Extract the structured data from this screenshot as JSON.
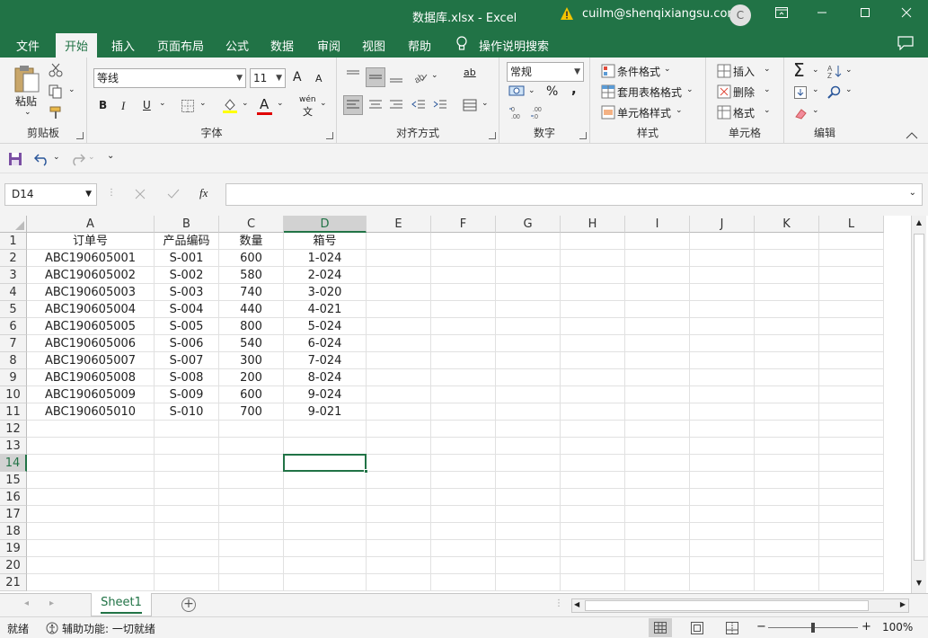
{
  "window": {
    "title": "数据库.xlsx  -  Excel",
    "user": "cuilm@shenqixiangsu.com",
    "avatar_initial": "C"
  },
  "menu": {
    "tabs": [
      "文件",
      "开始",
      "插入",
      "页面布局",
      "公式",
      "数据",
      "审阅",
      "视图",
      "帮助"
    ],
    "active_tab": "开始",
    "search": "操作说明搜索"
  },
  "ribbon": {
    "clipboard": {
      "paste": "粘贴",
      "group": "剪贴板"
    },
    "font": {
      "name": "等线",
      "size": "11",
      "grow": "A",
      "shrink": "A",
      "bold": "B",
      "italic": "I",
      "underline": "U",
      "font_color": "A",
      "phonetic_top": "wén",
      "phonetic_bottom": "文",
      "group": "字体"
    },
    "alignment": {
      "group": "对齐方式",
      "wrap": "ab"
    },
    "number": {
      "format": "常规",
      "percent": "%",
      "comma": ",",
      "group": "数字"
    },
    "styles": {
      "conditional": "条件格式",
      "table": "套用表格格式",
      "cell": "单元格样式",
      "group": "样式"
    },
    "cells": {
      "insert": "插入",
      "delete": "删除",
      "format": "格式",
      "group": "单元格"
    },
    "editing": {
      "group": "编辑"
    }
  },
  "formula_bar": {
    "name_box": "D14",
    "fx": "fx",
    "formula": ""
  },
  "grid": {
    "columns": [
      "A",
      "B",
      "C",
      "D",
      "E",
      "F",
      "G",
      "H",
      "I",
      "J",
      "K",
      "L"
    ],
    "selected_column": "D",
    "selected_row": "14",
    "row_numbers": [
      "1",
      "2",
      "3",
      "4",
      "5",
      "6",
      "7",
      "8",
      "9",
      "10",
      "11",
      "12",
      "13",
      "14",
      "15",
      "16",
      "17",
      "18",
      "19",
      "20",
      "21"
    ],
    "rows": [
      [
        "订单号",
        "产品编码",
        "数量",
        "箱号"
      ],
      [
        "ABC190605001",
        "S-001",
        "600",
        "1-024"
      ],
      [
        "ABC190605002",
        "S-002",
        "580",
        "2-024"
      ],
      [
        "ABC190605003",
        "S-003",
        "740",
        "3-020"
      ],
      [
        "ABC190605004",
        "S-004",
        "440",
        "4-021"
      ],
      [
        "ABC190605005",
        "S-005",
        "800",
        "5-024"
      ],
      [
        "ABC190605006",
        "S-006",
        "540",
        "6-024"
      ],
      [
        "ABC190605007",
        "S-007",
        "300",
        "7-024"
      ],
      [
        "ABC190605008",
        "S-008",
        "200",
        "8-024"
      ],
      [
        "ABC190605009",
        "S-009",
        "600",
        "9-024"
      ],
      [
        "ABC190605010",
        "S-010",
        "700",
        "9-021"
      ]
    ]
  },
  "sheets": {
    "tabs": [
      "Sheet1"
    ],
    "active": "Sheet1",
    "add": "+"
  },
  "status": {
    "ready": "就绪",
    "accessibility": "辅助功能: 一切就绪",
    "zoom": "100%",
    "zoom_out": "−",
    "zoom_in": "+"
  },
  "colors": {
    "accent": "#217346",
    "ribbon_bg": "#f3f3f3",
    "gridline": "#e1e1e1"
  }
}
